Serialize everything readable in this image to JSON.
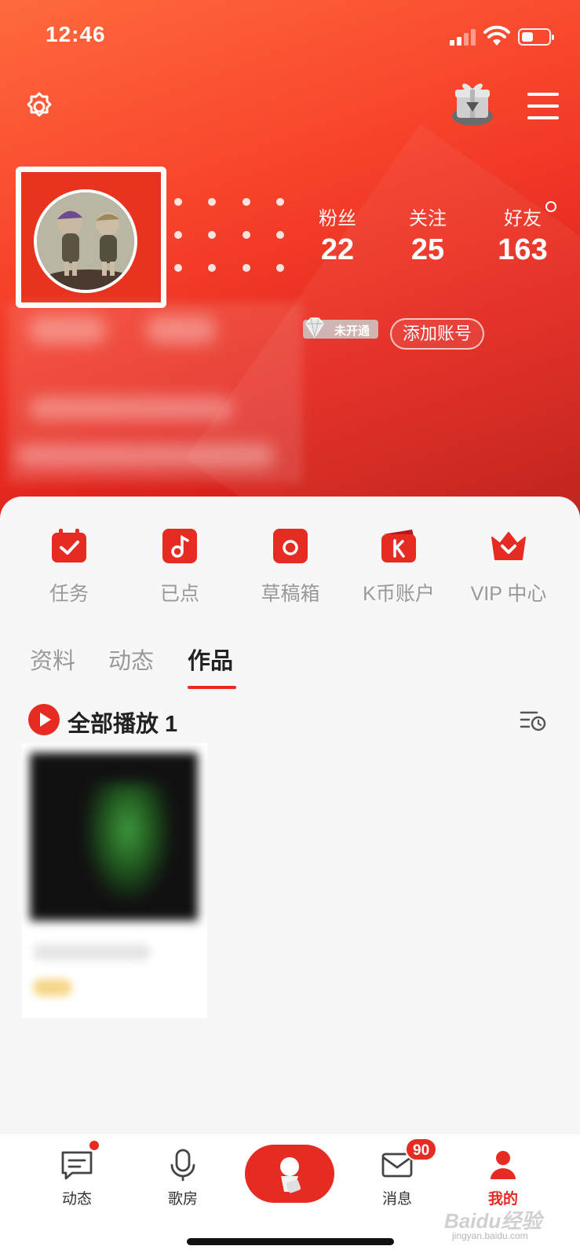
{
  "status_bar": {
    "time": "12:46"
  },
  "profile": {
    "stats": [
      {
        "label": "粉丝",
        "value": "22"
      },
      {
        "label": "关注",
        "value": "25"
      },
      {
        "label": "好友",
        "value": "163"
      }
    ],
    "vip_badge": "未开通",
    "add_account": "添加账号"
  },
  "quick_actions": [
    {
      "label": "任务",
      "icon": "task-check-icon"
    },
    {
      "label": "已点",
      "icon": "music-note-icon"
    },
    {
      "label": "草稿箱",
      "icon": "draft-box-icon"
    },
    {
      "label": "K币账户",
      "icon": "k-coin-wallet-icon"
    },
    {
      "label": "VIP 中心",
      "icon": "vip-crown-icon"
    }
  ],
  "tabs": [
    {
      "label": "资料",
      "active": false
    },
    {
      "label": "动态",
      "active": false
    },
    {
      "label": "作品",
      "active": true
    }
  ],
  "works": {
    "play_all": "全部播放 1"
  },
  "bottom_nav": [
    {
      "label": "动态",
      "icon": "feed-chat-icon",
      "dot": true
    },
    {
      "label": "歌房",
      "icon": "microphone-icon"
    },
    {
      "label": "",
      "icon": "record-sing-icon"
    },
    {
      "label": "消息",
      "icon": "mail-icon",
      "badge": "90"
    },
    {
      "label": "我的",
      "icon": "user-profile-icon",
      "active": true
    }
  ],
  "watermark": {
    "text": "Baidu经验",
    "sub": "jingyan.baidu.com"
  },
  "colors": {
    "brand_red": "#e62b23",
    "header_gradient_start": "#ff6a3d",
    "header_gradient_end": "#b81712"
  }
}
